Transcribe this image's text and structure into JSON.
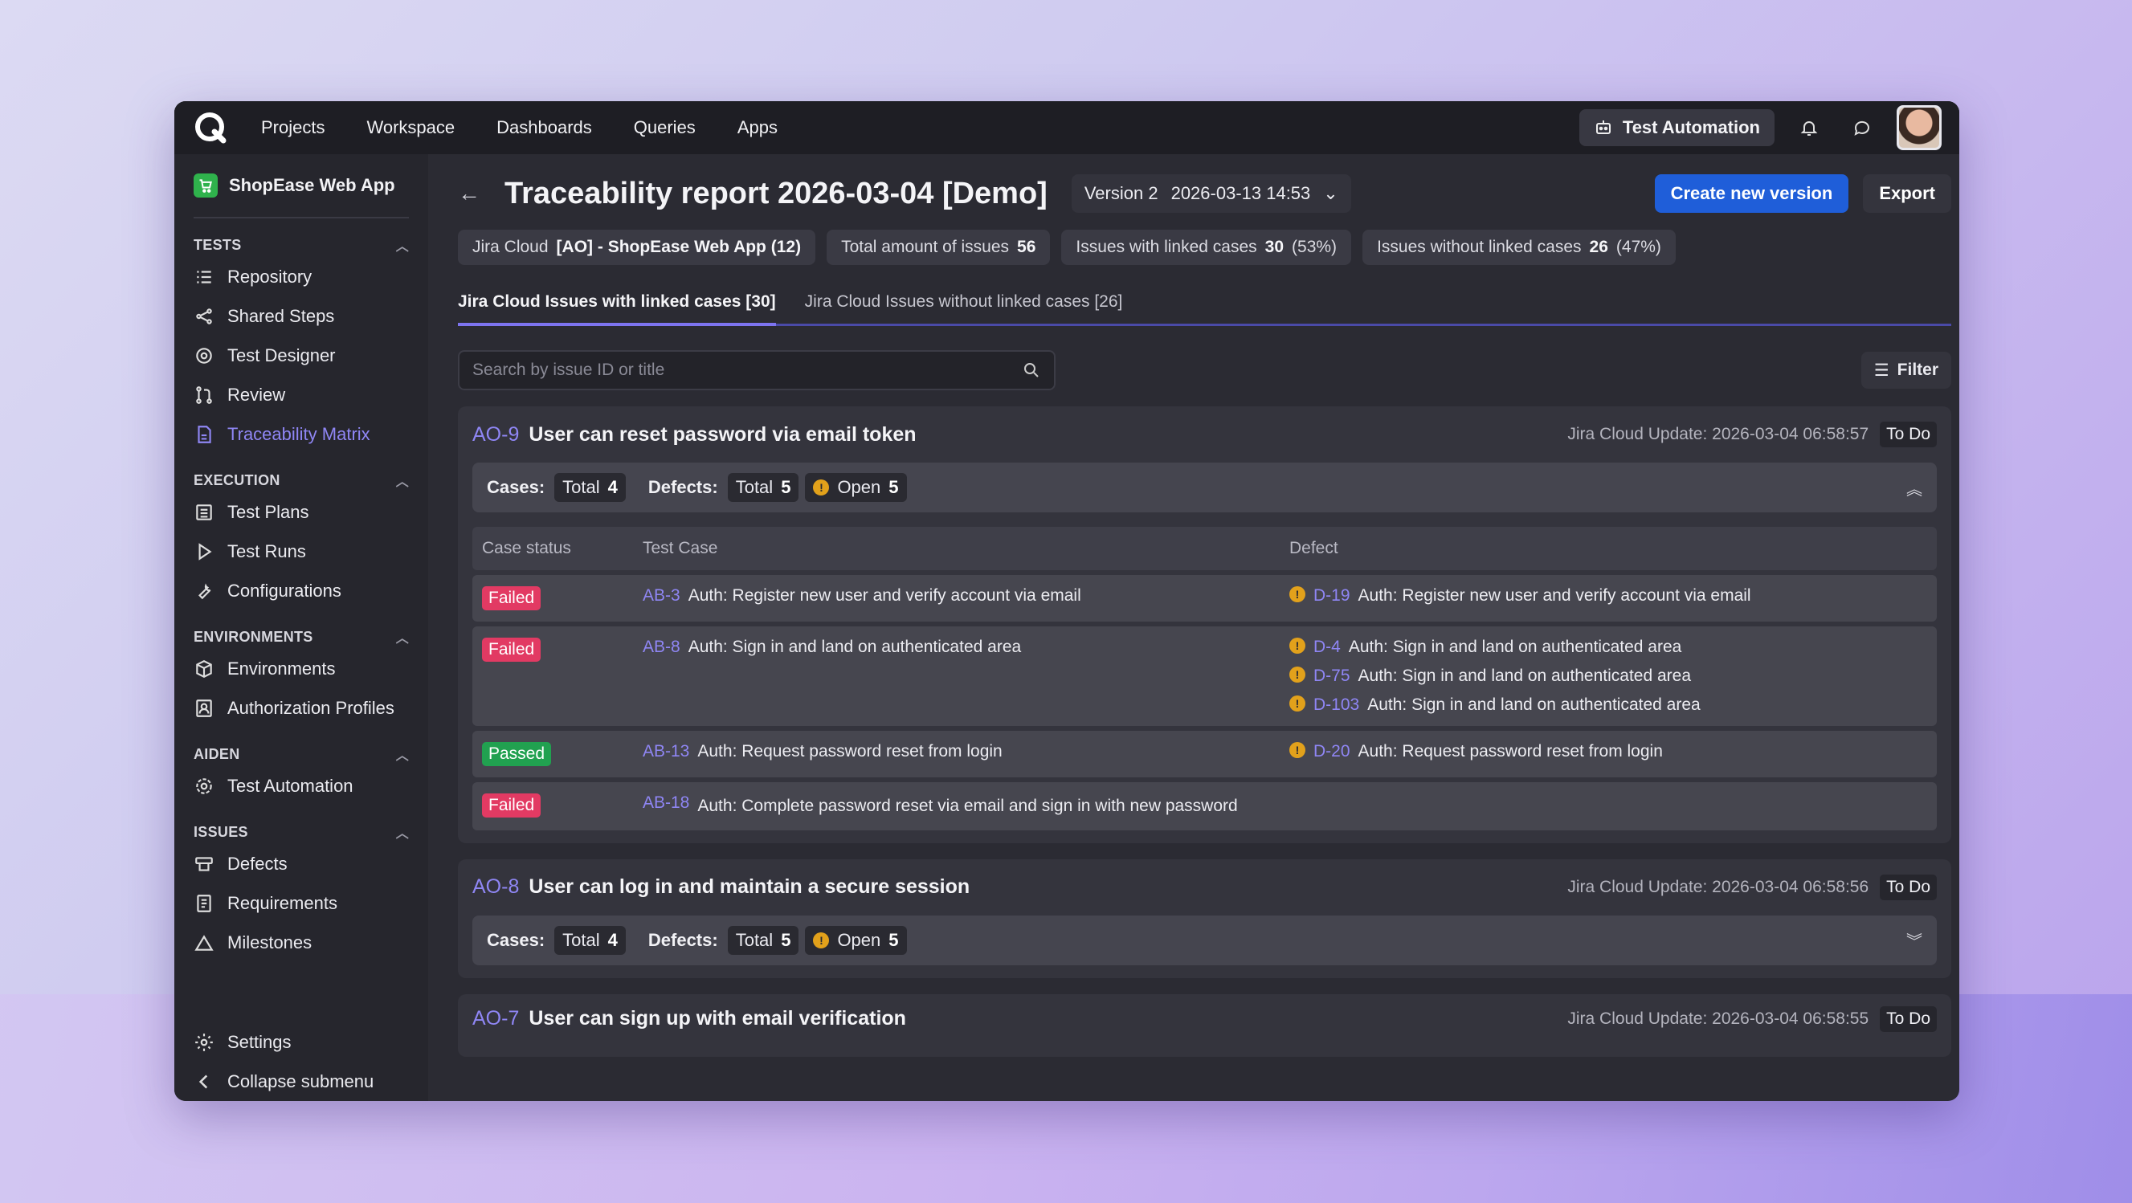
{
  "nav": {
    "items": [
      "Projects",
      "Workspace",
      "Dashboards",
      "Queries",
      "Apps"
    ],
    "test_automation": "Test Automation"
  },
  "sidebar": {
    "project": "ShopEase Web App",
    "sections": [
      {
        "title": "TESTS",
        "items": [
          "Repository",
          "Shared Steps",
          "Test Designer",
          "Review",
          "Traceability Matrix"
        ]
      },
      {
        "title": "EXECUTION",
        "items": [
          "Test Plans",
          "Test Runs",
          "Configurations"
        ]
      },
      {
        "title": "ENVIRONMENTS",
        "items": [
          "Environments",
          "Authorization Profiles"
        ]
      },
      {
        "title": "AIDEN",
        "items": [
          "Test Automation"
        ]
      },
      {
        "title": "ISSUES",
        "items": [
          "Defects",
          "Requirements",
          "Milestones"
        ]
      }
    ],
    "settings": "Settings",
    "collapse": "Collapse submenu"
  },
  "page": {
    "title": "Traceability report 2026-03-04 [Demo]",
    "version": "Version 2",
    "version_date": "2026-03-13 14:53",
    "create_btn": "Create new version",
    "export_btn": "Export"
  },
  "stats": {
    "jira_label": "Jira Cloud",
    "jira_value": "[AO] - ShopEase Web App (12)",
    "total_label": "Total amount of issues",
    "total_value": "56",
    "linked_label": "Issues with linked cases",
    "linked_value": "30",
    "linked_pct": "(53%)",
    "unlinked_label": "Issues without linked cases",
    "unlinked_value": "26",
    "unlinked_pct": "(47%)"
  },
  "tabs": {
    "with": "Jira Cloud Issues with linked cases [30]",
    "without": "Jira Cloud Issues without linked cases [26]"
  },
  "search": {
    "placeholder": "Search by issue ID or title"
  },
  "filter": "Filter",
  "labels": {
    "cases": "Cases:",
    "defects": "Defects:",
    "total": "Total",
    "open": "Open",
    "col_status": "Case status",
    "col_case": "Test Case",
    "col_defect": "Defect"
  },
  "issues": [
    {
      "id": "AO-9",
      "title": "User can reset password via email token",
      "update": "Jira Cloud Update: 2026-03-04 06:58:57",
      "status": "To Do",
      "cases_total": "4",
      "defects_total": "5",
      "defects_open": "5",
      "rows": [
        {
          "status": "Failed",
          "case_id": "AB-3",
          "case": "Auth: Register new user and verify account via email",
          "defects": [
            {
              "id": "D-19",
              "title": "Auth: Register new user and verify account via email"
            }
          ]
        },
        {
          "status": "Failed",
          "case_id": "AB-8",
          "case": "Auth: Sign in and land on authenticated area",
          "defects": [
            {
              "id": "D-4",
              "title": "Auth: Sign in and land on authenticated area"
            },
            {
              "id": "D-75",
              "title": "Auth: Sign in and land on authenticated area"
            },
            {
              "id": "D-103",
              "title": "Auth: Sign in and land on authenticated area"
            }
          ]
        },
        {
          "status": "Passed",
          "case_id": "AB-13",
          "case": "Auth: Request password reset from login",
          "defects": [
            {
              "id": "D-20",
              "title": "Auth: Request password reset from login"
            }
          ]
        },
        {
          "status": "Failed",
          "case_id": "AB-18",
          "case": "Auth: Complete password reset via email and sign in with new password",
          "defects": []
        }
      ]
    },
    {
      "id": "AO-8",
      "title": "User can log in and maintain a secure session",
      "update": "Jira Cloud Update: 2026-03-04 06:58:56",
      "status": "To Do",
      "cases_total": "4",
      "defects_total": "5",
      "defects_open": "5"
    },
    {
      "id": "AO-7",
      "title": "User can sign up with email verification",
      "update": "Jira Cloud Update: 2026-03-04 06:58:55",
      "status": "To Do"
    }
  ]
}
